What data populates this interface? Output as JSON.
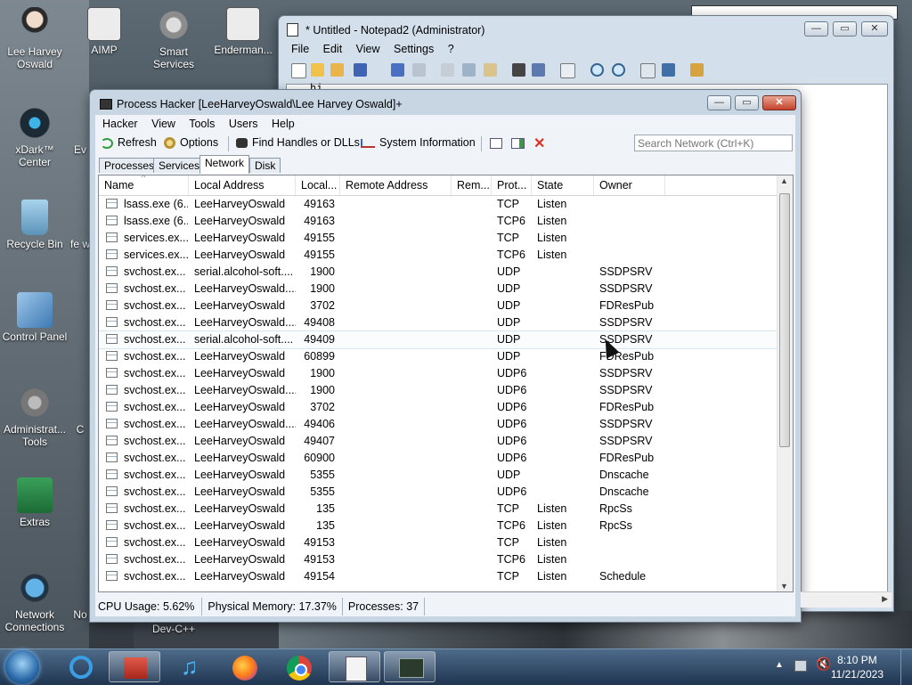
{
  "desktop": {
    "icons": [
      {
        "label": "Lee Harvey Oswald",
        "icon": "user-icon"
      },
      {
        "label": "AIMP",
        "icon": "app-icon"
      },
      {
        "label": "Smart Services",
        "icon": "gear-icon"
      },
      {
        "label": "Enderman...",
        "icon": "app-icon"
      },
      {
        "label": "xDark™ Center",
        "icon": "camera-icon"
      },
      {
        "label": "Ev",
        "icon": "app-icon"
      },
      {
        "label": "Recycle Bin",
        "icon": "recycle-bin-icon"
      },
      {
        "label": "fe w",
        "icon": "app-icon"
      },
      {
        "label": "Control Panel",
        "icon": "control-panel-icon"
      },
      {
        "label": "Administrat... Tools",
        "icon": "tools-icon"
      },
      {
        "label": "C",
        "icon": "app-icon"
      },
      {
        "label": "Extras",
        "icon": "folder-icon"
      },
      {
        "label": "Network Connections",
        "icon": "network-icon"
      },
      {
        "label": "No",
        "icon": "app-icon"
      },
      {
        "label": "Dev-C++",
        "icon": "app-icon"
      }
    ]
  },
  "notepad": {
    "title": "* Untitled - Notepad2 (Administrator)",
    "menu": [
      "File",
      "Edit",
      "View",
      "Settings",
      "?"
    ],
    "editor_text": "hi"
  },
  "processhacker": {
    "title": "Process Hacker [LeeHarveyOswald\\Lee Harvey Oswald]+",
    "menu": [
      "Hacker",
      "View",
      "Tools",
      "Users",
      "Help"
    ],
    "toolbar": {
      "refresh": "Refresh",
      "options": "Options",
      "find_handles": "Find Handles or DLLs",
      "system_info": "System Information"
    },
    "search_placeholder": "Search Network (Ctrl+K)",
    "tabs": [
      "Processes",
      "Services",
      "Network",
      "Disk"
    ],
    "active_tab": "Network",
    "columns": [
      "Name",
      "Local Address",
      "Local...",
      "Remote Address",
      "Rem...",
      "Prot...",
      "State",
      "Owner"
    ],
    "rows": [
      [
        "lsass.exe (6...",
        "LeeHarveyOswald",
        "49163",
        "",
        "",
        "TCP",
        "Listen",
        ""
      ],
      [
        "lsass.exe (6...",
        "LeeHarveyOswald",
        "49163",
        "",
        "",
        "TCP6",
        "Listen",
        ""
      ],
      [
        "services.ex...",
        "LeeHarveyOswald",
        "49155",
        "",
        "",
        "TCP",
        "Listen",
        ""
      ],
      [
        "services.ex...",
        "LeeHarveyOswald",
        "49155",
        "",
        "",
        "TCP6",
        "Listen",
        ""
      ],
      [
        "svchost.ex...",
        "serial.alcohol-soft....",
        "1900",
        "",
        "",
        "UDP",
        "",
        "SSDPSRV"
      ],
      [
        "svchost.ex...",
        "LeeHarveyOswald....",
        "1900",
        "",
        "",
        "UDP",
        "",
        "SSDPSRV"
      ],
      [
        "svchost.ex...",
        "LeeHarveyOswald",
        "3702",
        "",
        "",
        "UDP",
        "",
        "FDResPub"
      ],
      [
        "svchost.ex...",
        "LeeHarveyOswald....",
        "49408",
        "",
        "",
        "UDP",
        "",
        "SSDPSRV"
      ],
      [
        "svchost.ex...",
        "serial.alcohol-soft....",
        "49409",
        "",
        "",
        "UDP",
        "",
        "SSDPSRV"
      ],
      [
        "svchost.ex...",
        "LeeHarveyOswald",
        "60899",
        "",
        "",
        "UDP",
        "",
        "FDResPub"
      ],
      [
        "svchost.ex...",
        "LeeHarveyOswald",
        "1900",
        "",
        "",
        "UDP6",
        "",
        "SSDPSRV"
      ],
      [
        "svchost.ex...",
        "LeeHarveyOswald....",
        "1900",
        "",
        "",
        "UDP6",
        "",
        "SSDPSRV"
      ],
      [
        "svchost.ex...",
        "LeeHarveyOswald",
        "3702",
        "",
        "",
        "UDP6",
        "",
        "FDResPub"
      ],
      [
        "svchost.ex...",
        "LeeHarveyOswald....",
        "49406",
        "",
        "",
        "UDP6",
        "",
        "SSDPSRV"
      ],
      [
        "svchost.ex...",
        "LeeHarveyOswald",
        "49407",
        "",
        "",
        "UDP6",
        "",
        "SSDPSRV"
      ],
      [
        "svchost.ex...",
        "LeeHarveyOswald",
        "60900",
        "",
        "",
        "UDP6",
        "",
        "FDResPub"
      ],
      [
        "svchost.ex...",
        "LeeHarveyOswald",
        "5355",
        "",
        "",
        "UDP",
        "",
        "Dnscache"
      ],
      [
        "svchost.ex...",
        "LeeHarveyOswald",
        "5355",
        "",
        "",
        "UDP6",
        "",
        "Dnscache"
      ],
      [
        "svchost.ex...",
        "LeeHarveyOswald",
        "135",
        "",
        "",
        "TCP",
        "Listen",
        "RpcSs"
      ],
      [
        "svchost.ex...",
        "LeeHarveyOswald",
        "135",
        "",
        "",
        "TCP6",
        "Listen",
        "RpcSs"
      ],
      [
        "svchost.ex...",
        "LeeHarveyOswald",
        "49153",
        "",
        "",
        "TCP",
        "Listen",
        ""
      ],
      [
        "svchost.ex...",
        "LeeHarveyOswald",
        "49153",
        "",
        "",
        "TCP6",
        "Listen",
        ""
      ],
      [
        "svchost.ex...",
        "LeeHarveyOswald",
        "49154",
        "",
        "",
        "TCP",
        "Listen",
        "Schedule"
      ]
    ],
    "selected_row": 8,
    "status": {
      "cpu": "CPU Usage: 5.62%",
      "memory": "Physical Memory: 17.37%",
      "processes": "Processes: 37"
    }
  },
  "taskbar": {
    "time": "8:10 PM",
    "date": "11/21/2023",
    "apps": [
      "start-orb-icon",
      "internet-explorer-icon",
      "store-icon",
      "music-icon",
      "firefox-icon",
      "chrome-icon",
      "notepad2-icon",
      "process-hacker-icon"
    ]
  },
  "colors": {
    "title_glass": "#c8d6e4",
    "close_red": "#c3432a",
    "taskbar": "#1f3550"
  }
}
